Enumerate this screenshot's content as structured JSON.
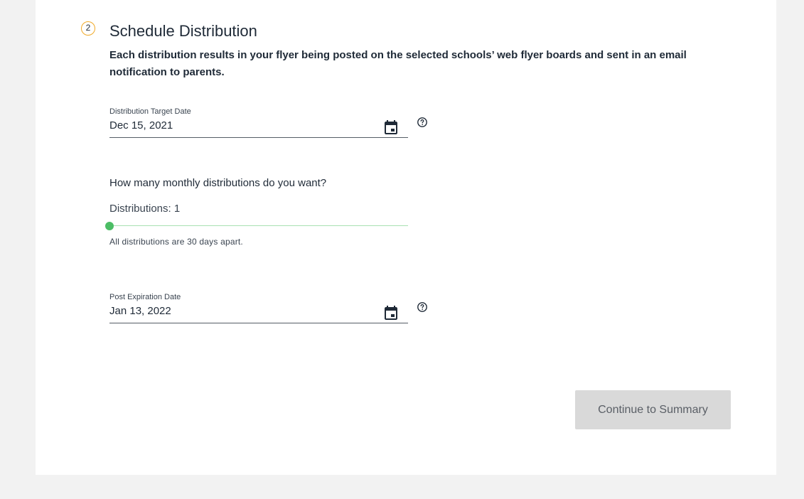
{
  "step": {
    "number": "2",
    "title": "Schedule Distribution",
    "description": "Each distribution results in your flyer being posted on the selected schools’ web flyer boards and sent in an email notification to parents."
  },
  "target_date": {
    "label": "Distribution Target Date",
    "value": "Dec 15, 2021",
    "icon": "calendar-icon",
    "help_icon": "help-circle-icon"
  },
  "distributions": {
    "question": "How many monthly distributions do you want?",
    "count_label": "Distributions: 1",
    "value": 1,
    "min": 1,
    "hint": "All distributions are 30 days apart.",
    "accent_color": "#4cbd65"
  },
  "expiration_date": {
    "label": "Post Expiration Date",
    "value": "Jan 13, 2022",
    "icon": "calendar-icon",
    "help_icon": "help-circle-icon"
  },
  "actions": {
    "continue_label": "Continue to Summary"
  },
  "colors": {
    "badge_border": "#f0a928",
    "button_bg": "#d9d9d9",
    "page_bg": "#f2f2f2"
  }
}
